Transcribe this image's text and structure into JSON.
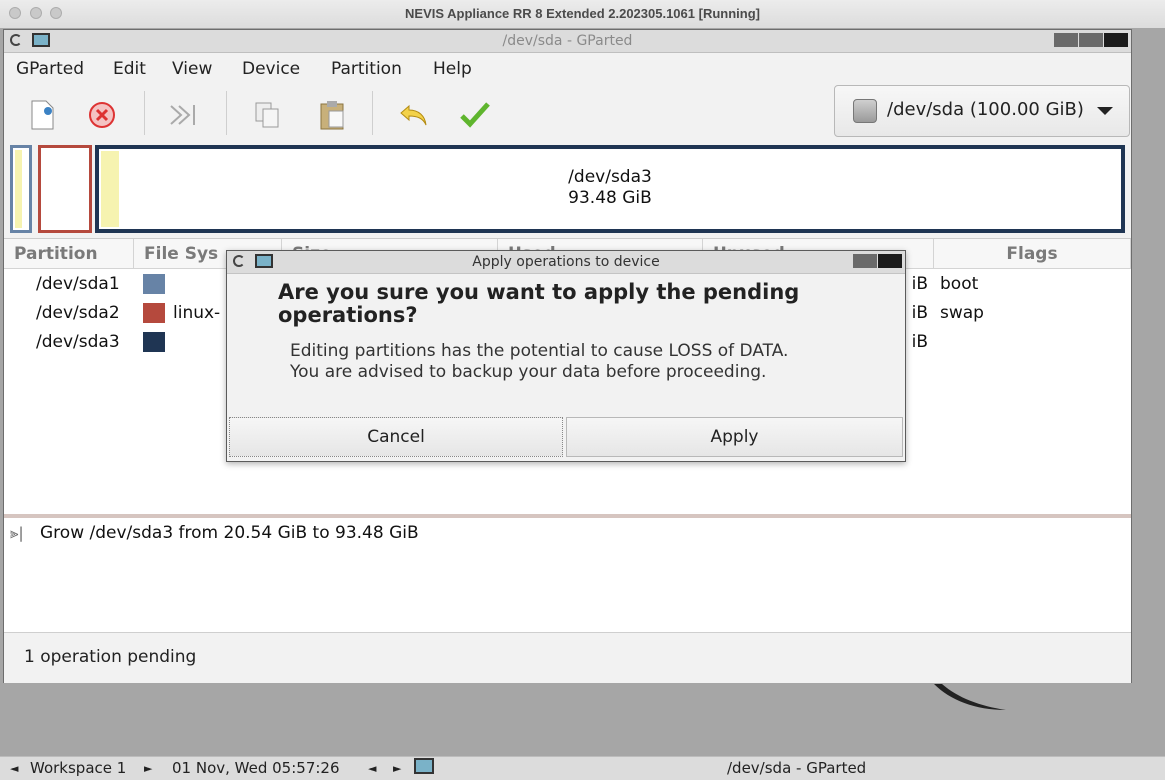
{
  "host_window": {
    "title": "NEVIS Appliance RR 8 Extended 2.202305.1061 [Running]"
  },
  "gparted": {
    "title": "/dev/sda - GParted",
    "menu": [
      "GParted",
      "Edit",
      "View",
      "Device",
      "Partition",
      "Help"
    ],
    "toolbar_icons": [
      "new-icon",
      "delete-icon",
      "resize-move-icon",
      "copy-icon",
      "paste-icon",
      "undo-icon",
      "apply-icon"
    ],
    "device_selector": "/dev/sda (100.00 GiB)",
    "disk_visual": {
      "name": "/dev/sda3",
      "size": "93.48 GiB"
    },
    "table": {
      "headers": [
        "Partition",
        "File Sys",
        "Size",
        "Used",
        "Unused",
        "Flags"
      ],
      "rows": [
        {
          "partition": "/dev/sda1",
          "filesystem": "",
          "tail": "iB",
          "flags": "boot",
          "color": "#6783a6"
        },
        {
          "partition": "/dev/sda2",
          "filesystem": "linux-",
          "tail": "iB",
          "flags": "swap",
          "color": "#b5493d"
        },
        {
          "partition": "/dev/sda3",
          "filesystem": "",
          "tail": "iB",
          "flags": "",
          "color": "#1f3553"
        }
      ]
    },
    "operations": [
      "Grow /dev/sda3 from 20.54 GiB to 93.48 GiB"
    ],
    "status": "1 operation pending"
  },
  "dialog": {
    "title": "Apply operations to device",
    "heading": "Are you sure you want to apply the pending operations?",
    "line1": "Editing partitions has the potential to cause LOSS of DATA.",
    "line2": "You are advised to backup your data before proceeding.",
    "cancel": "Cancel",
    "apply": "Apply"
  },
  "taskbar": {
    "workspace": "Workspace 1",
    "clock": "01 Nov, Wed 05:57:26",
    "window": "/dev/sda - GParted"
  }
}
